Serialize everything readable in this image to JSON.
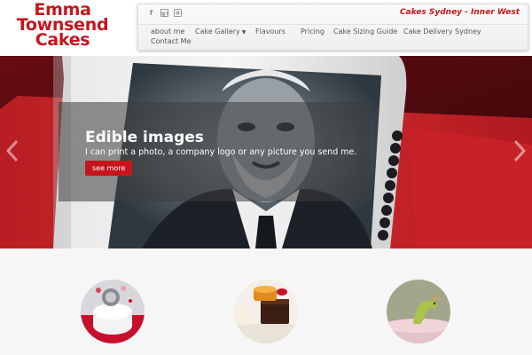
{
  "header": {
    "logo_lines": [
      "Emma",
      "Townsend",
      "Cakes"
    ],
    "tagline": "Cakes Sydney - Inner West",
    "social_icons": [
      "facebook-icon",
      "google-plus-icon",
      "instagram-icon"
    ]
  },
  "nav": {
    "items": [
      {
        "label": "about me"
      },
      {
        "label": "Cake Gallery"
      },
      {
        "label": "Flavours"
      },
      {
        "label": "Pricing"
      },
      {
        "label": "Cake Sizing Guide"
      },
      {
        "label": "Cake Delivery Sydney"
      },
      {
        "label": "Contact Me"
      }
    ]
  },
  "hero": {
    "title": "Edible images",
    "subtitle": "I can print a photo, a company logo or any picture you send me.",
    "button_label": "see more",
    "prev_icon": "chevron-left-icon",
    "next_icon": "chevron-right-icon"
  },
  "thumbnails": [
    {
      "name": "red-white-cake-thumbnail"
    },
    {
      "name": "petit-fours-thumbnail"
    },
    {
      "name": "green-bird-cake-thumbnail"
    }
  ],
  "colors": {
    "brand_red": "#c4161c",
    "nav_text": "#555555"
  }
}
